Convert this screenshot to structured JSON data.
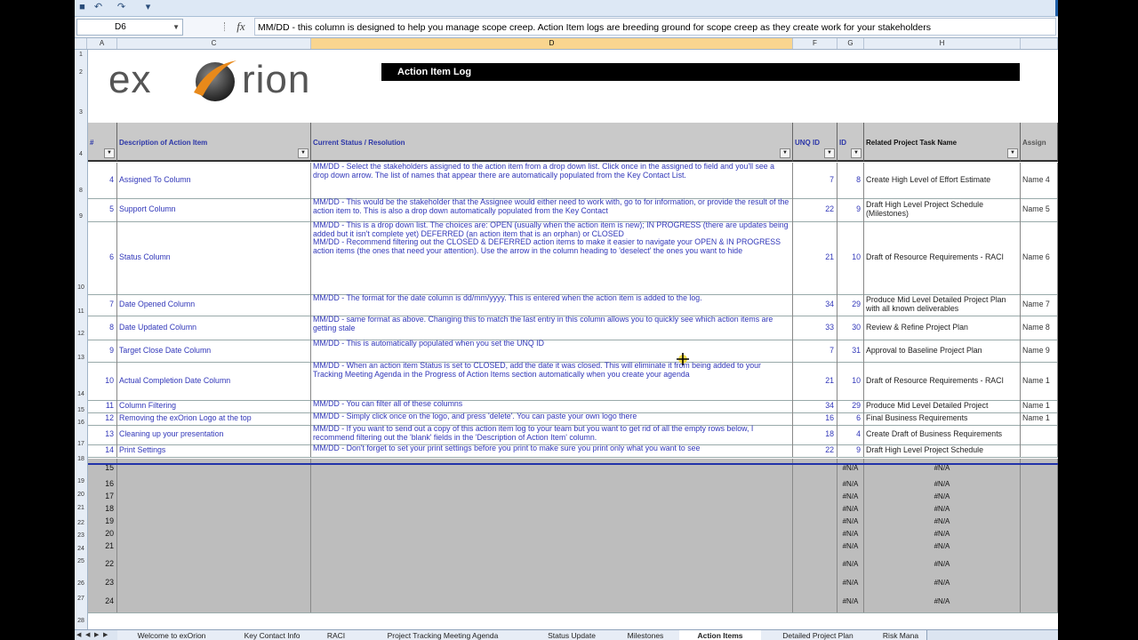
{
  "name_box": "D6",
  "formula_text": "MM/DD - this column is designed to help you manage scope creep. Action Item logs are breeding ground for scope creep as they create work for your stakeholders",
  "columns": [
    "A",
    "C",
    "D",
    "F",
    "G",
    "H"
  ],
  "row_numbers": [
    "1",
    "2",
    "3",
    "4",
    "8",
    "9",
    "10",
    "11",
    "12",
    "13",
    "14",
    "15",
    "16",
    "17",
    "18",
    "19",
    "20",
    "21",
    "22",
    "23",
    "24",
    "25",
    "26",
    "27",
    "28"
  ],
  "logo": {
    "left": "ex",
    "right": "rion"
  },
  "title": "Action Item Log",
  "headers": {
    "num": "#",
    "desc": "Description of Action Item",
    "status": "Current Status / Resolution",
    "unq": "UNQ ID",
    "id": "ID",
    "task": "Related Project Task Name",
    "assignee": "Assign"
  },
  "rows": [
    {
      "num": "4",
      "desc": "Assigned To Column",
      "status": "MM/DD - Select the stakeholders assigned to the action item from a drop down list. Click once in the assigned to field and you'll see a drop down arrow. The list of names that appear there are automatically populated from the Key Contact List.",
      "unq": "7",
      "id": "8",
      "task": "Create High Level of Effort Estimate",
      "asg": "Name 4"
    },
    {
      "num": "5",
      "desc": "Support Column",
      "status": "MM/DD - This would be the stakeholder that the Assignee would either need to work with, go to for information, or provide the result of the action item to. This is also a drop down automatically populated from the Key Contact",
      "unq": "22",
      "id": "9",
      "task": "Draft High Level Project Schedule (Milestones)",
      "asg": "Name 5"
    },
    {
      "num": "6",
      "desc": "Status Column",
      "status": "MM/DD - This is a drop down list. The choices are: OPEN (usually when the action item is new); IN PROGRESS (there are updates being added but it isn't complete yet) DEFERRED (an action item that is an orphan) or CLOSED\nMM/DD - Recommend filtering out the CLOSED & DEFERRED action items to make it easier to navigate your OPEN & IN PROGRESS action items (the ones that need your attention). Use the arrow in the column heading to 'deselect' the ones you want to hide",
      "unq": "21",
      "id": "10",
      "task": "Draft of Resource Requirements - RACI",
      "asg": "Name 6"
    },
    {
      "num": "7",
      "desc": "Date Opened Column",
      "status": "MM/DD - The format for the date column is dd/mm/yyyy. This is entered when the action item is added to the log.",
      "unq": "34",
      "id": "29",
      "task": "Produce Mid Level Detailed Project Plan with all known deliverables",
      "asg": "Name 7"
    },
    {
      "num": "8",
      "desc": "Date Updated Column",
      "status": "MM/DD - same format as above. Changing this to match the last entry in this column allows you to quickly see which action items are getting stale",
      "unq": "33",
      "id": "30",
      "task": "Review & Refine Project Plan",
      "asg": "Name 8"
    },
    {
      "num": "9",
      "desc": "Target Close Date Column",
      "status": "MM/DD - This is automatically populated when you set the UNQ ID",
      "unq": "7",
      "id": "31",
      "task": "Approval to Baseline Project Plan",
      "asg": "Name 9"
    },
    {
      "num": "10",
      "desc": "Actual Completion Date Column",
      "status": "MM/DD - When an action item Status is set to CLOSED, add the date it was closed. This will eliminate it from being added to your Tracking Meeting Agenda in the Progress of Action Items section automatically when you create your agenda",
      "unq": "21",
      "id": "10",
      "task": "Draft of Resource Requirements - RACI",
      "asg": "Name 1"
    },
    {
      "num": "11",
      "desc": "Column Filtering",
      "status": "MM/DD - You can filter all of these columns",
      "unq": "34",
      "id": "29",
      "task": "Produce Mid Level Detailed Project",
      "asg": "Name 1"
    },
    {
      "num": "12",
      "desc": "Removing the exOrion Logo at the top",
      "status": "MM/DD - Simply click once on the logo, and press 'delete'. You can paste your own logo there",
      "unq": "16",
      "id": "6",
      "task": "Final Business Requirements",
      "asg": "Name 1"
    },
    {
      "num": "13",
      "desc": "Cleaning up your presentation",
      "status": "MM/DD - If you want to send out a copy of this action item log to your team but you want to get rid of all the empty rows below, I recommend filtering out the 'blank' fields in the 'Description of Action Item' column.",
      "unq": "18",
      "id": "4",
      "task": "Create Draft of Business Requirements",
      "asg": ""
    },
    {
      "num": "14",
      "desc": "Print Settings",
      "status": "MM/DD - Don't forget to set your print settings before you print to make sure you print only what you want to see",
      "unq": "22",
      "id": "9",
      "task": "Draft High Level Project Schedule",
      "asg": ""
    }
  ],
  "empty_rows": [
    {
      "num": "15",
      "id": "#N/A",
      "task": "#N/A"
    },
    {
      "num": "16",
      "id": "#N/A",
      "task": "#N/A"
    },
    {
      "num": "17",
      "id": "#N/A",
      "task": "#N/A"
    },
    {
      "num": "18",
      "id": "#N/A",
      "task": "#N/A"
    },
    {
      "num": "19",
      "id": "#N/A",
      "task": "#N/A"
    },
    {
      "num": "20",
      "id": "#N/A",
      "task": "#N/A"
    },
    {
      "num": "21",
      "id": "#N/A",
      "task": "#N/A"
    },
    {
      "num": "22",
      "id": "#N/A",
      "task": "#N/A"
    },
    {
      "num": "23",
      "id": "#N/A",
      "task": "#N/A"
    },
    {
      "num": "24",
      "id": "#N/A",
      "task": "#N/A"
    }
  ],
  "tabs": [
    "Welcome to exOrion",
    "Key Contact Info",
    "RACI",
    "Project Tracking Meeting Agenda",
    "Status Update",
    "Milestones",
    "Action Items",
    "Detailed Project Plan",
    "Risk Mana"
  ],
  "active_tab": "Action Items",
  "colors": {
    "text_blue": "#3137b9",
    "header_grey": "#c9c9c9",
    "empty_grey": "#bdbdbd",
    "accent_orange": "#e8891a"
  }
}
